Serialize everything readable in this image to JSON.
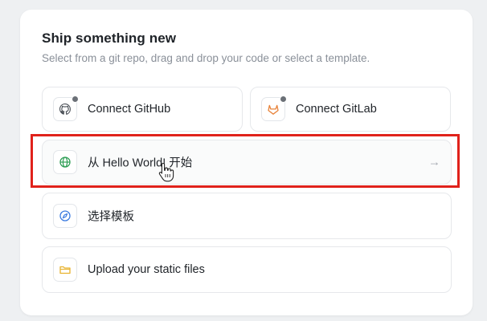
{
  "header": {
    "title": "Ship something new",
    "subtitle": "Select from a git repo, drag and drop your code or select a template."
  },
  "options": {
    "github": {
      "label": "Connect GitHub",
      "icon": "github-icon"
    },
    "gitlab": {
      "label": "Connect GitLab",
      "icon": "gitlab-icon"
    },
    "hello": {
      "label": "从 Hello World! 开始",
      "icon": "globe-icon"
    },
    "template": {
      "label": "选择模板",
      "icon": "compass-icon"
    },
    "upload": {
      "label": "Upload your static files",
      "icon": "folder-icon"
    }
  },
  "colors": {
    "highlight": "#e0221b",
    "gitlab": "#e8833a",
    "globe": "#2e9e55",
    "compass": "#3b7be0",
    "folder": "#e8b22e"
  }
}
